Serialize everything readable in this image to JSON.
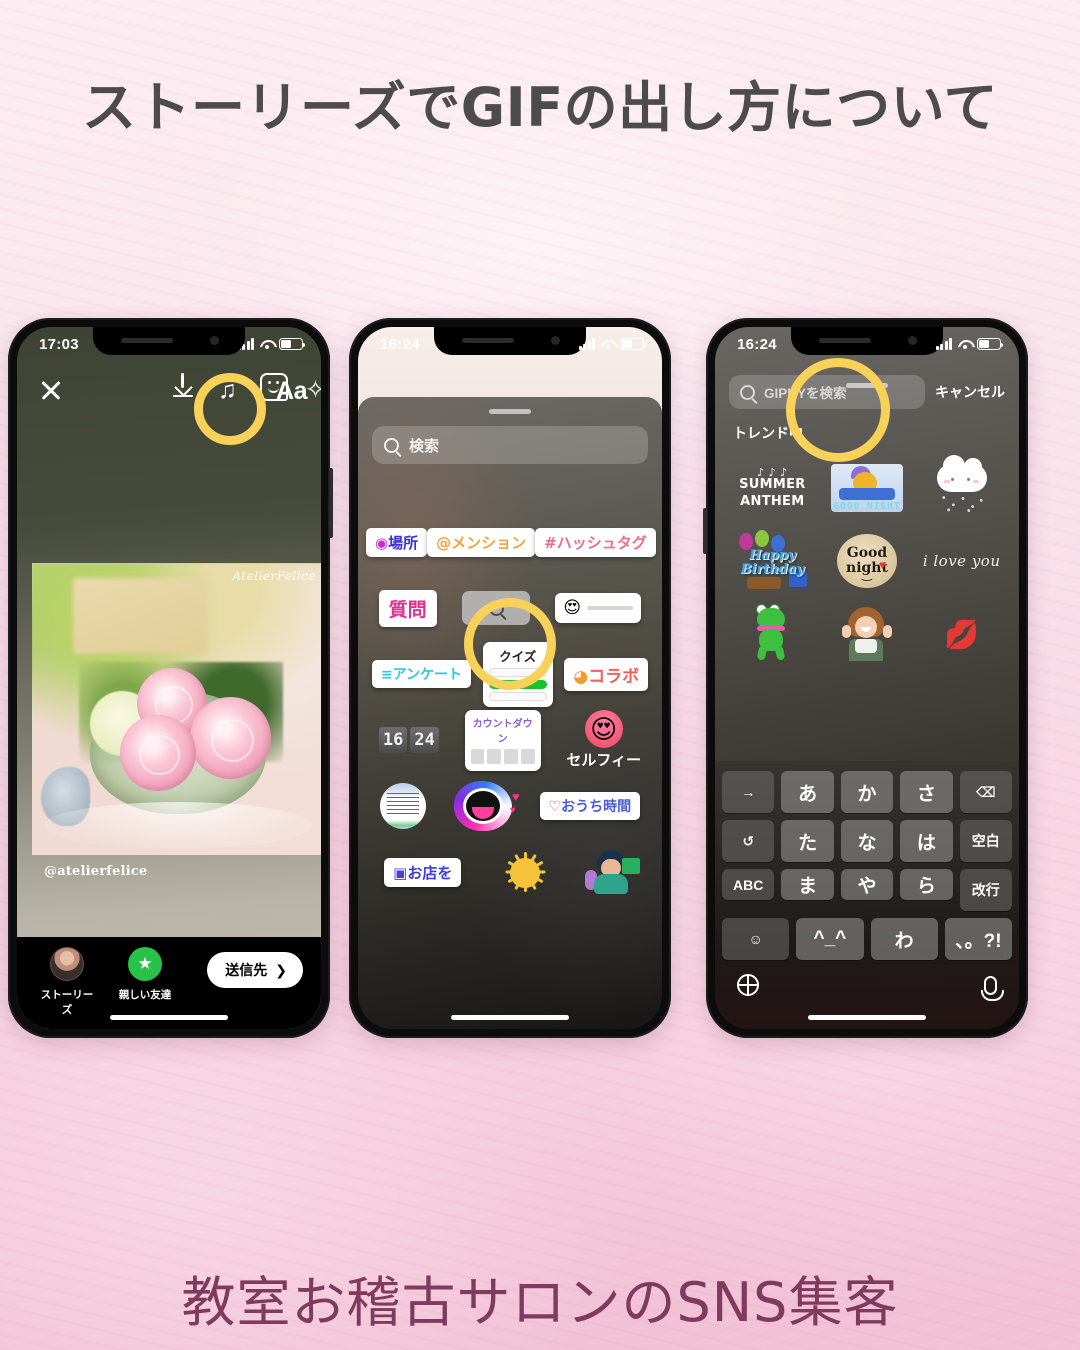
{
  "headline": "ストーリーズでGIFの出し方について",
  "footer": "教室お稽古サロンのSNS集客",
  "colors": {
    "bg_top": "#fcedf2",
    "bg_bottom": "#f2c2d6",
    "headline_text": "#4c4c4c",
    "footer_text": "#7f3a5e",
    "highlight_ring": "#f7d158"
  },
  "phone1": {
    "status": {
      "time": "17:03",
      "signal": "signal-bars-icon",
      "wifi": "wifi-icon",
      "battery": "battery-icon"
    },
    "toolbar": {
      "close": "close-icon",
      "download": "download-icon",
      "music": "music-note-icon",
      "sticker": "sticker-smiley-icon",
      "effects": "effects-icon",
      "text": "Aa"
    },
    "photo": {
      "watermark": "AtelierFelice",
      "caption": "@atelierfelice"
    },
    "bottom": {
      "story_label": "ストーリーズ",
      "close_friends_label": "親しい友達",
      "close_friends_icon": "star-icon",
      "send_to": "送信先",
      "send_to_chevron": "chevron-right-icon"
    }
  },
  "phone2": {
    "status": {
      "time": "16:24"
    },
    "search_placeholder": "検索",
    "search_icon": "search-icon",
    "stickers": {
      "row1": [
        {
          "label": "場所",
          "icon": "location-pin-icon"
        },
        {
          "label": "@メンション"
        },
        {
          "label": "#ハッシュタグ"
        }
      ],
      "row2": [
        {
          "label": "質問"
        },
        {
          "label": "",
          "icon": "gif-search-icon"
        },
        {
          "label": "",
          "icon": "emoji-slider-icon",
          "emoji": "😍"
        }
      ],
      "row3": [
        {
          "label": "アンケート"
        },
        {
          "label": "クイズ"
        },
        {
          "label": "コラボ"
        }
      ],
      "row4": [
        {
          "label": "16 24",
          "icon": "clock-time-sticker"
        },
        {
          "label": "カウントダウン"
        },
        {
          "label": "セルフィー"
        }
      ],
      "row5": [
        {
          "label": "",
          "icon": "note-photo-sticker"
        },
        {
          "label": "",
          "icon": "open-mouth-sticker"
        },
        {
          "label": "おうち時間"
        }
      ],
      "row6": [
        {
          "label": "お店を",
          "icon": "shop-bag-icon"
        },
        {
          "label": "",
          "icon": "sunrise-sticker"
        },
        {
          "label": "",
          "icon": "person-sticker"
        }
      ]
    },
    "time_digits": [
      "16",
      "24"
    ]
  },
  "phone3": {
    "status": {
      "time": "16:24"
    },
    "search_placeholder": "GIPHYを検索",
    "search_icon": "search-icon",
    "cancel": "キャンセル",
    "section_title": "トレンド中",
    "gifs": [
      {
        "name": "summer-anthem-gif",
        "text": "SUMMER ANTHEM"
      },
      {
        "name": "pooh-good-night-gif",
        "text": "GOOD NIGHT"
      },
      {
        "name": "rain-cloud-gif",
        "text": ""
      },
      {
        "name": "happy-birthday-gif",
        "text": "Happy Birthday"
      },
      {
        "name": "good-night-smiley-gif",
        "text": "Good night"
      },
      {
        "name": "i-love-you-gif",
        "text": "i love you"
      },
      {
        "name": "frog-dancing-gif",
        "text": ""
      },
      {
        "name": "girl-excited-gif",
        "text": ""
      },
      {
        "name": "pink-lips-gif",
        "text": "💋"
      }
    ],
    "keyboard": {
      "rows": [
        [
          "→",
          "あ",
          "か",
          "さ",
          "⌫"
        ],
        [
          "↺",
          "た",
          "な",
          "は",
          "空白"
        ],
        [
          "ABC",
          "ま",
          "や",
          "ら",
          "改行"
        ],
        [
          "☺",
          "^_^",
          "わ",
          "、。?!"
        ]
      ],
      "globe": "globe-icon",
      "mic": "microphone-icon"
    }
  }
}
